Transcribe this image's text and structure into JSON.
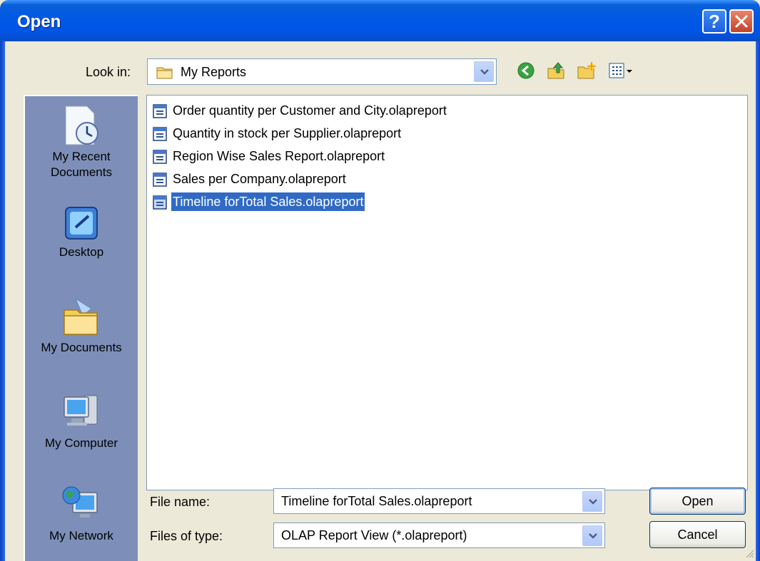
{
  "window": {
    "title": "Open",
    "help_glyph": "?",
    "close_icon": "close-x-icon"
  },
  "lookin": {
    "label": "Look in:",
    "value": "My Reports",
    "icon": "folder-icon",
    "toolbar": [
      "back-icon",
      "up-folder-icon",
      "new-folder-icon",
      "view-menu-icon"
    ]
  },
  "places": [
    {
      "label_line1": "My Recent",
      "label_line2": "Documents",
      "icon": "recent-documents-icon"
    },
    {
      "label_line1": "Desktop",
      "label_line2": "",
      "icon": "desktop-icon"
    },
    {
      "label_line1": "My Documents",
      "label_line2": "",
      "icon": "my-documents-icon"
    },
    {
      "label_line1": "My Computer",
      "label_line2": "",
      "icon": "my-computer-icon"
    },
    {
      "label_line1": "My Network",
      "label_line2": "",
      "icon": "my-network-icon"
    }
  ],
  "files": [
    {
      "name": "Order quantity per Customer and City.olapreport",
      "selected": false
    },
    {
      "name": "Quantity in stock per Supplier.olapreport",
      "selected": false
    },
    {
      "name": "Region Wise Sales Report.olapreport",
      "selected": false
    },
    {
      "name": "Sales per Company.olapreport",
      "selected": false
    },
    {
      "name": "Timeline forTotal Sales.olapreport",
      "selected": true
    }
  ],
  "filename": {
    "label": "File name:",
    "value": "Timeline forTotal Sales.olapreport"
  },
  "filetype": {
    "label": "Files of type:",
    "value": "OLAP Report View (*.olapreport)"
  },
  "buttons": {
    "open": "Open",
    "cancel": "Cancel"
  },
  "colors": {
    "titlebar": "#0054e3",
    "selection": "#316ac5",
    "places_bar": "#7d8fb8",
    "dialog": "#ece9d8"
  }
}
